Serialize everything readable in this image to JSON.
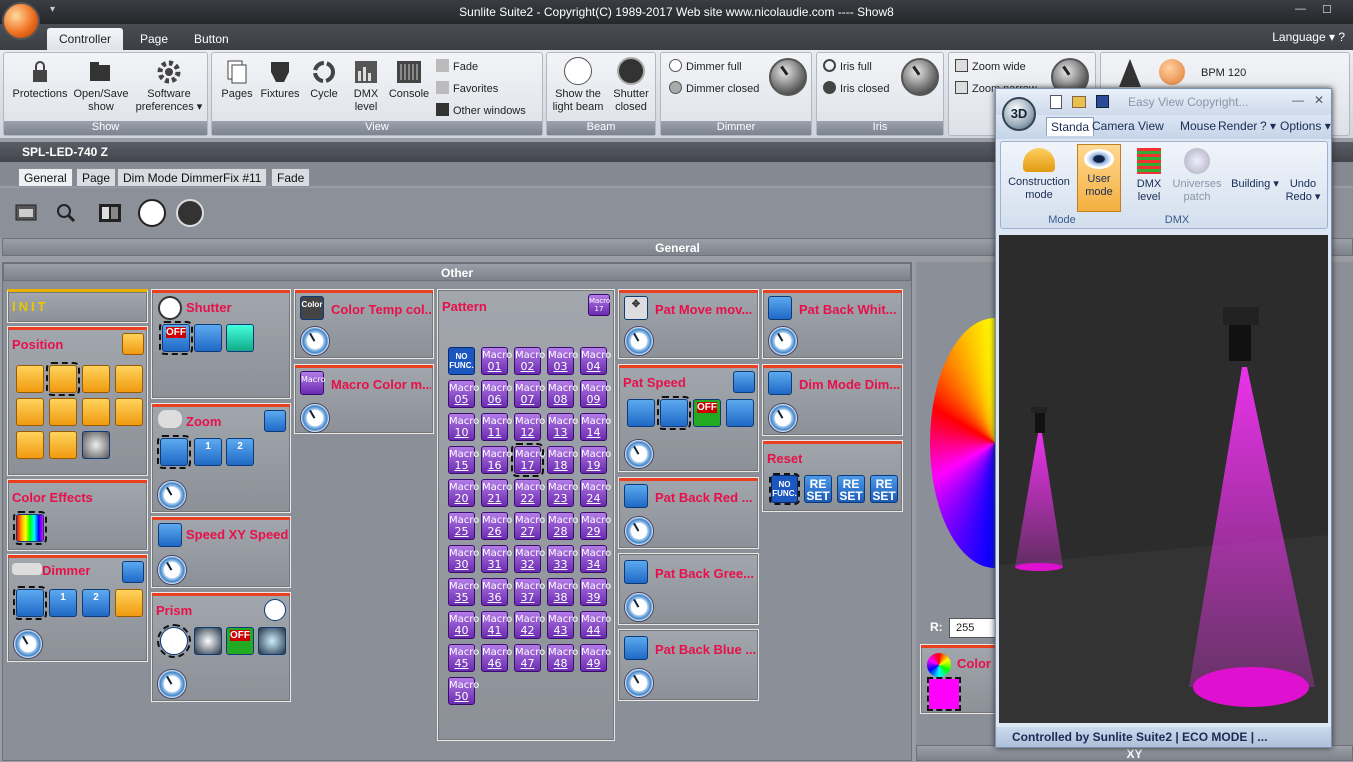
{
  "window": {
    "title": "Sunlite Suite2 - Copyright(C) 1989-2017    Web site www.nicolaudie.com ---- Show8",
    "qa": "▾"
  },
  "tabs": {
    "controller": "Controller",
    "page": "Page",
    "button": "Button",
    "language": "Language ▾  ?"
  },
  "ribbon": {
    "show": {
      "label": "Show",
      "protections": "Protections",
      "open_save": "Open/Save show",
      "software": "Software preferences ▾"
    },
    "view": {
      "label": "View",
      "pages": "Pages",
      "fixtures": "Fixtures",
      "cycle": "Cycle",
      "dmx_level": "DMX level",
      "console": "Console",
      "fade": "Fade",
      "favorites": "Favorites",
      "other_windows": "Other windows"
    },
    "beam": {
      "label": "Beam",
      "show_beam": "Show the light beam",
      "shutter_closed": "Shutter closed"
    },
    "dimmer": {
      "label": "Dimmer",
      "full": "Dimmer full",
      "closed": "Dimmer closed"
    },
    "iris": {
      "label": "Iris",
      "full": "Iris full",
      "closed": "Iris closed"
    },
    "zoom": {
      "wide": "Zoom wide",
      "narrow": "Zoom narrow"
    },
    "bpm": "BPM 120"
  },
  "fixture_name": "SPL-LED-740 Z",
  "subtabs": {
    "general": "General",
    "page": "Page",
    "dim_mode": "Dim Mode DimmerFix #11",
    "fade": "Fade"
  },
  "sections": {
    "general": "General",
    "other": "Other",
    "xy": "XY"
  },
  "panels": {
    "init": "INIT",
    "position": "Position",
    "color_effects": "Color Effects",
    "dimmer": "Dimmer",
    "shutter": "Shutter",
    "zoom": "Zoom",
    "speed_xy": "Speed XY Speed",
    "prism": "Prism",
    "color_temp": "Color Temp col...",
    "macro_color": "Macro Color m...",
    "pattern": "Pattern",
    "pattern_badge": "Macro 17",
    "pat_move": "Pat Move mov...",
    "pat_speed": "Pat Speed",
    "pat_back_red": "Pat Back Red ...",
    "pat_back_green": "Pat Back Gree...",
    "pat_back_blue": "Pat Back Blue ...",
    "pat_back_white": "Pat Back Whit...",
    "dim_mode": "Dim Mode Dim...",
    "reset": "Reset",
    "color": "Color"
  },
  "icons": {
    "off": "OFF",
    "nofunc": "NO FUNC.",
    "reset": "RE SET",
    "color": "Color",
    "macro": "Macro"
  },
  "macro_label": "Macro",
  "macros": [
    "01",
    "02",
    "03",
    "04",
    "05",
    "06",
    "07",
    "08",
    "09",
    "10",
    "11",
    "12",
    "13",
    "14",
    "15",
    "16",
    "17",
    "18",
    "19",
    "20",
    "21",
    "22",
    "23",
    "24",
    "25",
    "26",
    "27",
    "28",
    "29",
    "30",
    "31",
    "32",
    "33",
    "34",
    "35",
    "36",
    "37",
    "38",
    "39",
    "40",
    "41",
    "42",
    "43",
    "44",
    "45",
    "46",
    "47",
    "48",
    "49",
    "50"
  ],
  "selected_macro": "17",
  "rgb": {
    "r_label": "R:",
    "r_value": "255"
  },
  "viewer": {
    "title": "Easy View   Copyright...",
    "tabs": {
      "standard": "Standa",
      "camera": "Camera",
      "view": "View",
      "mouse": "Mouse",
      "render": "Render",
      "help": "? ▾",
      "options": "Options ▾"
    },
    "construction": "Construction mode",
    "user": "User mode",
    "mode_label": "Mode",
    "dmx_level": "DMX level",
    "universes": "Universes patch",
    "dmx_label": "DMX",
    "building": "Building ▾",
    "undo": "Undo Redo ▾",
    "status": "Controlled by Sunlite Suite2  |  ECO MODE  |  ..."
  }
}
